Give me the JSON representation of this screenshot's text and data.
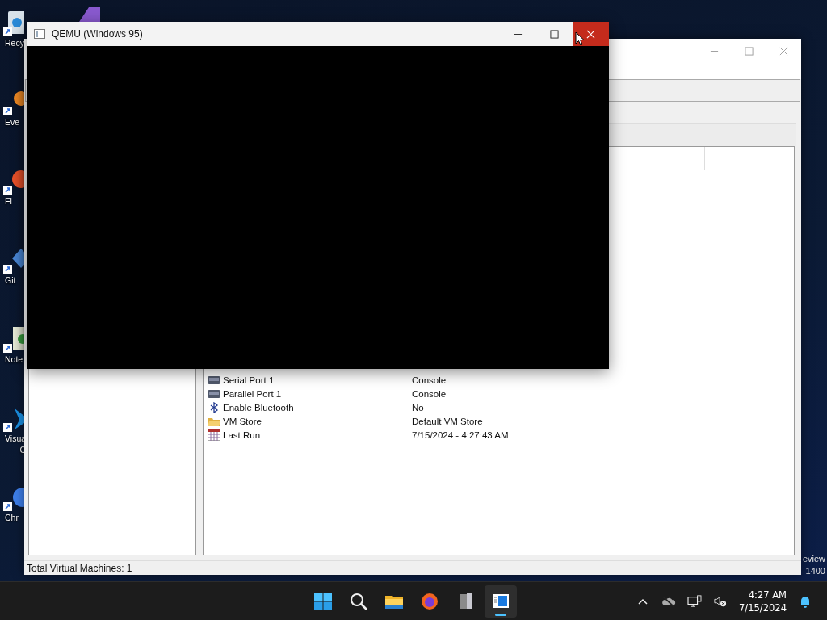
{
  "desktop_icons": [
    {
      "label": "Recy",
      "kind": "bin"
    },
    {
      "label": "Eve",
      "kind": "orange"
    },
    {
      "label": "Fi",
      "kind": "firefox"
    },
    {
      "label": "Git",
      "kind": "diamond"
    },
    {
      "label": "Note",
      "kind": "notepad"
    },
    {
      "label": "Visua\nC",
      "kind": "vscode"
    },
    {
      "label": "Chr",
      "kind": "chrome"
    }
  ],
  "wallpaper_text": [
    "eview",
    "1400"
  ],
  "manager_window": {
    "rows": [
      {
        "name": "Serial Port 1",
        "value": "Console",
        "kind": "port"
      },
      {
        "name": "Parallel Port 1",
        "value": "Console",
        "kind": "port"
      },
      {
        "name": "Enable Bluetooth",
        "value": "No",
        "kind": "bluetooth"
      },
      {
        "name": "VM Store",
        "value": "Default VM Store",
        "kind": "folder"
      },
      {
        "name": "Last Run",
        "value": "7/15/2024 - 4:27:43 AM",
        "kind": "calendar"
      }
    ],
    "status_bar": "Total Virtual Machines: 1"
  },
  "qemu_window": {
    "title": "QEMU (Windows 95)"
  },
  "taskbar": {
    "apps": [
      {
        "kind": "start",
        "selected": false
      },
      {
        "kind": "search",
        "selected": false
      },
      {
        "kind": "folder",
        "selected": false
      },
      {
        "kind": "firefox",
        "selected": false
      },
      {
        "kind": "vmmanager",
        "selected": false
      },
      {
        "kind": "qemu",
        "selected": true
      }
    ],
    "time": "4:27 AM",
    "date": "7/15/2024"
  }
}
